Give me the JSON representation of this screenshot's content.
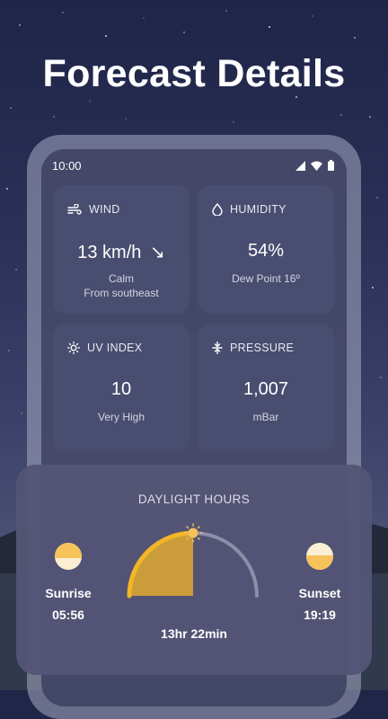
{
  "headline": "Forecast Details",
  "status": {
    "time": "10:00"
  },
  "cards": {
    "wind": {
      "title": "WIND",
      "value": "13 km/h",
      "arrow": "↘",
      "sub1": "Calm",
      "sub2": "From southeast",
      "icon": "wind-icon"
    },
    "humidity": {
      "title": "HUMIDITY",
      "value": "54%",
      "sub1": "Dew Point 16º",
      "icon": "droplet-icon"
    },
    "uv": {
      "title": "UV INDEX",
      "value": "10",
      "sub1": "Very High",
      "icon": "sun-icon"
    },
    "pressure": {
      "title": "PRESSURE",
      "value": "1,007",
      "sub1": "mBar",
      "icon": "pressure-icon"
    }
  },
  "daylight": {
    "title": "DAYLIGHT HOURS",
    "sunrise_label": "Sunrise",
    "sunrise_time": "05:56",
    "sunset_label": "Sunset",
    "sunset_time": "19:19",
    "duration": "13hr 22min",
    "day_progress": 0.5
  },
  "colors": {
    "accent": "#f2b627",
    "sun_fill": "#f6c25a",
    "card_bg": "#4a4e70",
    "panel_bg": "#545476"
  }
}
